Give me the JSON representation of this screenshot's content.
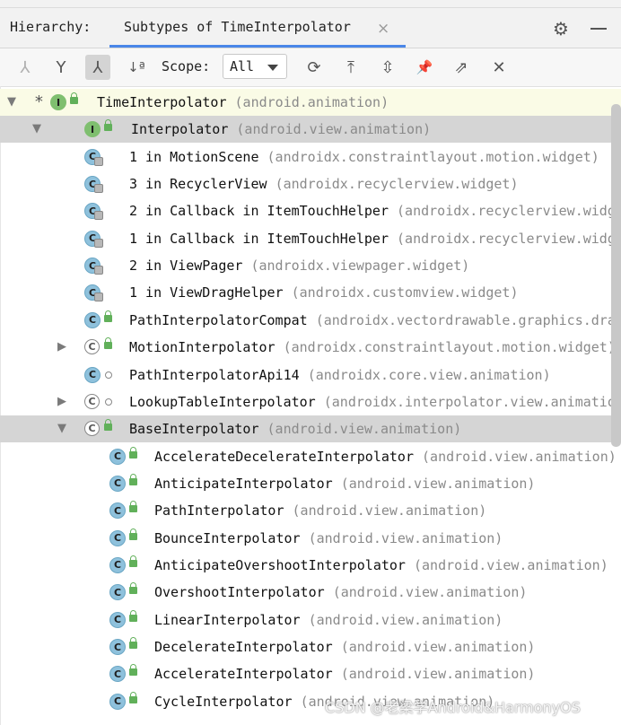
{
  "header": {
    "hierarchy_label": "Hierarchy:",
    "tab_label": "Subtypes of TimeInterpolator",
    "tab_close": "×",
    "settings_icon": "gear-icon",
    "minimize_icon": "minimize-icon"
  },
  "toolbar": {
    "buttons": [
      {
        "icon": "type-hierarchy-icon",
        "glyph": "⅄",
        "state": "disabled"
      },
      {
        "icon": "supertypes-icon",
        "glyph": "Y",
        "state": "normal"
      },
      {
        "icon": "subtypes-icon",
        "glyph": "⅄",
        "state": "active"
      },
      {
        "icon": "sort-alphabetically-icon",
        "glyph": "↓ª",
        "state": "normal"
      }
    ],
    "scope_label": "Scope:",
    "scope_value": "All",
    "actions": [
      {
        "icon": "refresh-icon",
        "glyph": "⟳"
      },
      {
        "icon": "export-icon",
        "glyph": "⤒"
      },
      {
        "icon": "expand-all-icon",
        "glyph": "⇳"
      },
      {
        "icon": "pin-icon",
        "glyph": "📌"
      },
      {
        "icon": "open-in-window-icon",
        "glyph": "⇗"
      },
      {
        "icon": "close-icon",
        "glyph": "✕"
      }
    ]
  },
  "tree": [
    {
      "level": 0,
      "expander": "down",
      "star": "*",
      "kind": "interface",
      "letter": "I",
      "access": "public",
      "name": "TimeInterpolator",
      "pkg": "(android.animation)",
      "style": "tint"
    },
    {
      "level": 1,
      "expander": "down",
      "kind": "interface",
      "letter": "I",
      "access": "public",
      "name": "Interpolator",
      "pkg": "(android.view.animation)",
      "style": "sel"
    },
    {
      "level": 2,
      "kind": "anon",
      "letter": "C",
      "name": "1 in MotionScene",
      "pkg": "(androidx.constraintlayout.motion.widget)"
    },
    {
      "level": 2,
      "kind": "anon",
      "letter": "C",
      "name": "3 in RecyclerView",
      "pkg": "(androidx.recyclerview.widget)"
    },
    {
      "level": 2,
      "kind": "anon",
      "letter": "C",
      "name": "2 in Callback in ItemTouchHelper",
      "pkg": "(androidx.recyclerview.widget)"
    },
    {
      "level": 2,
      "kind": "anon",
      "letter": "C",
      "name": "1 in Callback in ItemTouchHelper",
      "pkg": "(androidx.recyclerview.widget)"
    },
    {
      "level": 2,
      "kind": "anon",
      "letter": "C",
      "name": "2 in ViewPager",
      "pkg": "(androidx.viewpager.widget)"
    },
    {
      "level": 2,
      "kind": "anon",
      "letter": "C",
      "name": "1 in ViewDragHelper",
      "pkg": "(androidx.customview.widget)"
    },
    {
      "level": 2,
      "kind": "class",
      "letter": "C",
      "access": "public",
      "name": "PathInterpolatorCompat",
      "pkg": "(androidx.vectordrawable.graphics.drawable)"
    },
    {
      "level": 2,
      "expander": "right",
      "kind": "abstract",
      "letter": "C",
      "access": "public",
      "name": "MotionInterpolator",
      "pkg": "(androidx.constraintlayout.motion.widget)"
    },
    {
      "level": 2,
      "kind": "class",
      "letter": "C",
      "access": "package",
      "name": "PathInterpolatorApi14",
      "pkg": "(androidx.core.view.animation)"
    },
    {
      "level": 2,
      "expander": "right",
      "kind": "abstract",
      "letter": "C",
      "access": "package",
      "name": "LookupTableInterpolator",
      "pkg": "(androidx.interpolator.view.animation)"
    },
    {
      "level": 2,
      "expander": "down",
      "kind": "abstract",
      "letter": "C",
      "access": "public",
      "name": "BaseInterpolator",
      "pkg": "(android.view.animation)",
      "style": "sel"
    },
    {
      "level": 3,
      "kind": "class",
      "letter": "C",
      "access": "public",
      "name": "AccelerateDecelerateInterpolator",
      "pkg": "(android.view.animation)"
    },
    {
      "level": 3,
      "kind": "class",
      "letter": "C",
      "access": "public",
      "name": "AnticipateInterpolator",
      "pkg": "(android.view.animation)"
    },
    {
      "level": 3,
      "kind": "class",
      "letter": "C",
      "access": "public",
      "name": "PathInterpolator",
      "pkg": "(android.view.animation)"
    },
    {
      "level": 3,
      "kind": "class",
      "letter": "C",
      "access": "public",
      "name": "BounceInterpolator",
      "pkg": "(android.view.animation)"
    },
    {
      "level": 3,
      "kind": "class",
      "letter": "C",
      "access": "public",
      "name": "AnticipateOvershootInterpolator",
      "pkg": "(android.view.animation)"
    },
    {
      "level": 3,
      "kind": "class",
      "letter": "C",
      "access": "public",
      "name": "OvershootInterpolator",
      "pkg": "(android.view.animation)"
    },
    {
      "level": 3,
      "kind": "class",
      "letter": "C",
      "access": "public",
      "name": "LinearInterpolator",
      "pkg": "(android.view.animation)"
    },
    {
      "level": 3,
      "kind": "class",
      "letter": "C",
      "access": "public",
      "name": "DecelerateInterpolator",
      "pkg": "(android.view.animation)"
    },
    {
      "level": 3,
      "kind": "class",
      "letter": "C",
      "access": "public",
      "name": "AccelerateInterpolator",
      "pkg": "(android.view.animation)"
    },
    {
      "level": 3,
      "kind": "class",
      "letter": "C",
      "access": "public",
      "name": "CycleInterpolator",
      "pkg": "(android.view.animation)"
    }
  ],
  "watermark": "CSDN @老梁学Android&HarmonyOS",
  "colors": {
    "tab_accent": "#4a86e8",
    "interface_icon": "#7fbf6f",
    "class_icon": "#8ec1dc",
    "public_lock": "#61b05a",
    "selected_row": "#d5d5d5"
  }
}
